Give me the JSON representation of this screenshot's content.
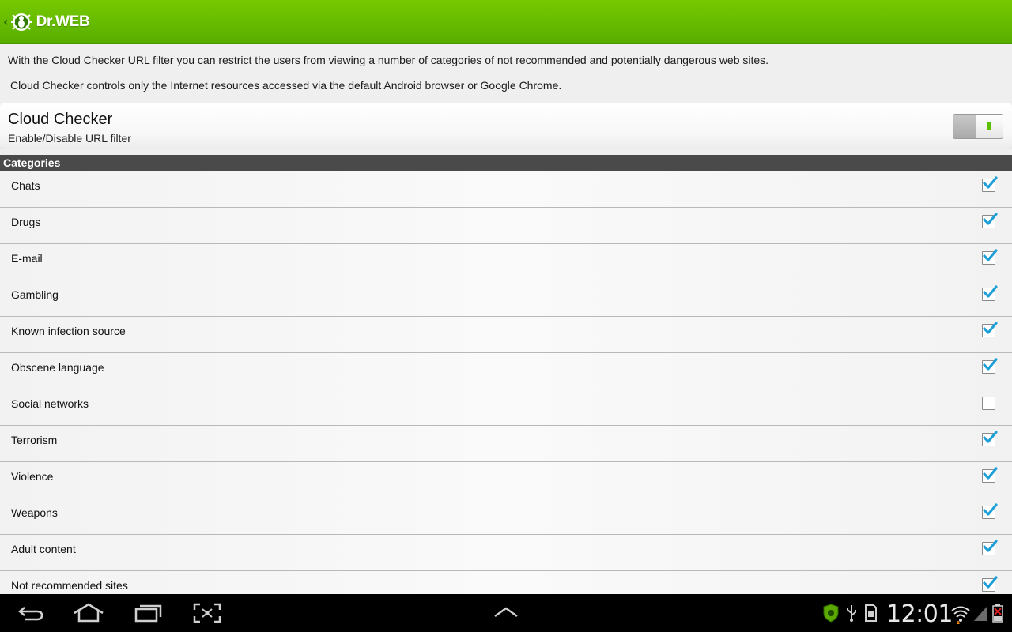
{
  "app": {
    "brand": "Dr.WEB",
    "accent_color": "#66bb00",
    "up_icon": "chevron-left-icon",
    "logo_icon": "drweb-spider-icon"
  },
  "intro": {
    "line1": "With the Cloud Checker URL filter you can restrict the users from viewing a number of categories of not recommended and potentially dangerous web sites.",
    "line2": "Cloud Checker controls only the Internet resources accessed via the default Android browser or Google Chrome."
  },
  "cloud_checker": {
    "title": "Cloud Checker",
    "subtitle": "Enable/Disable URL filter",
    "enabled": true
  },
  "categories": {
    "header": "Categories",
    "items": [
      {
        "label": "Chats",
        "checked": true
      },
      {
        "label": "Drugs",
        "checked": true
      },
      {
        "label": "E-mail",
        "checked": true
      },
      {
        "label": "Gambling",
        "checked": true
      },
      {
        "label": "Known infection source",
        "checked": true
      },
      {
        "label": "Obscene language",
        "checked": true
      },
      {
        "label": "Social networks",
        "checked": false
      },
      {
        "label": "Terrorism",
        "checked": true
      },
      {
        "label": "Violence",
        "checked": true
      },
      {
        "label": "Weapons",
        "checked": true
      },
      {
        "label": "Adult content",
        "checked": true
      },
      {
        "label": "Not recommended sites",
        "checked": true
      }
    ]
  },
  "navbar": {
    "buttons": [
      "back-icon",
      "home-icon",
      "recent-apps-icon",
      "screenshot-icon",
      "menu-up-icon"
    ]
  },
  "status_bar": {
    "time": "12:01",
    "icons": [
      "drweb-shield-icon",
      "usb-icon",
      "sd-card-icon",
      "wifi-icon",
      "signal-icon",
      "battery-icon"
    ]
  }
}
